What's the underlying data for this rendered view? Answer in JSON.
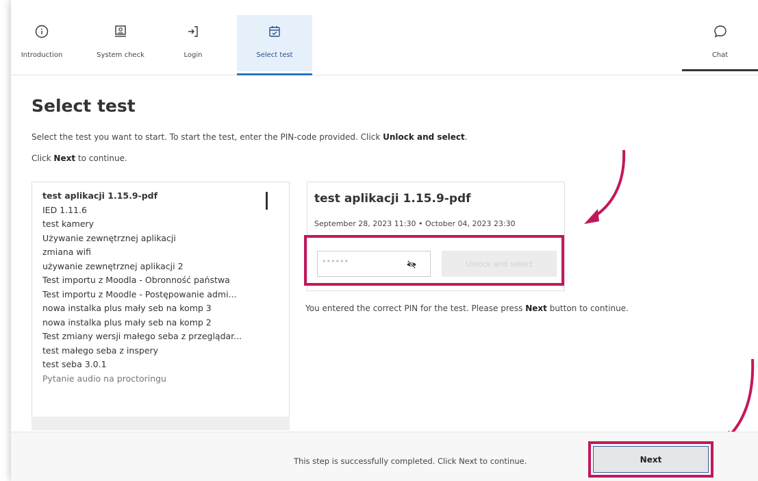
{
  "nav": {
    "steps": [
      {
        "label": "Introduction",
        "icon": "info-icon"
      },
      {
        "label": "System check",
        "icon": "computer-check-icon"
      },
      {
        "label": "Login",
        "icon": "login-icon"
      },
      {
        "label": "Select test",
        "icon": "calendar-check-icon",
        "active": true
      }
    ],
    "chat": {
      "label": "Chat",
      "icon": "chat-icon"
    }
  },
  "page": {
    "title": "Select test",
    "intro_line1_part1": "Select the test you want to start. To start the test, enter the PIN-code provided. Click ",
    "intro_line1_bold": "Unlock and select",
    "intro_line1_part2": ".",
    "intro_line2_part1": "Click ",
    "intro_line2_bold": "Next",
    "intro_line2_part2": " to continue."
  },
  "test_list": {
    "items": [
      "test aplikacji 1.15.9-pdf",
      "IED 1.11.6",
      "test kamery",
      "Używanie zewnętrznej aplikacji",
      "zmiana wifi",
      "używanie zewnętrznej aplikacji 2",
      "Test importu z Moodla - Obronność państwa",
      "Test importu z Moodle - Postępowanie admi...",
      "nowa instalka plus mały seb na komp 3",
      "nowa instalka plus mały seb na komp 2",
      "Test zmiany wersji małego seba z przeglądar...",
      "test małego seba z inspery",
      "test seba 3.0.1",
      "Pytanie audio na proctoringu"
    ],
    "selected_index": 0
  },
  "detail": {
    "title": "test aplikacji 1.15.9-pdf",
    "dates": "September 28, 2023 11:30 • October 04, 2023 23:30",
    "pin_value": "••••••",
    "pin_icon": "eye-off-icon",
    "unlock_label": "Unlock and select",
    "success_part1": "You entered the correct PIN for the test. Please press ",
    "success_bold": "Next",
    "success_part2": " button to continue."
  },
  "footer": {
    "message": "This step is successfully completed. Click Next to continue.",
    "next_label": "Next"
  },
  "colors": {
    "highlight": "#c2185b",
    "active_tab_bg": "#e6f0fb",
    "active_tab_underline": "#2a73c9"
  }
}
